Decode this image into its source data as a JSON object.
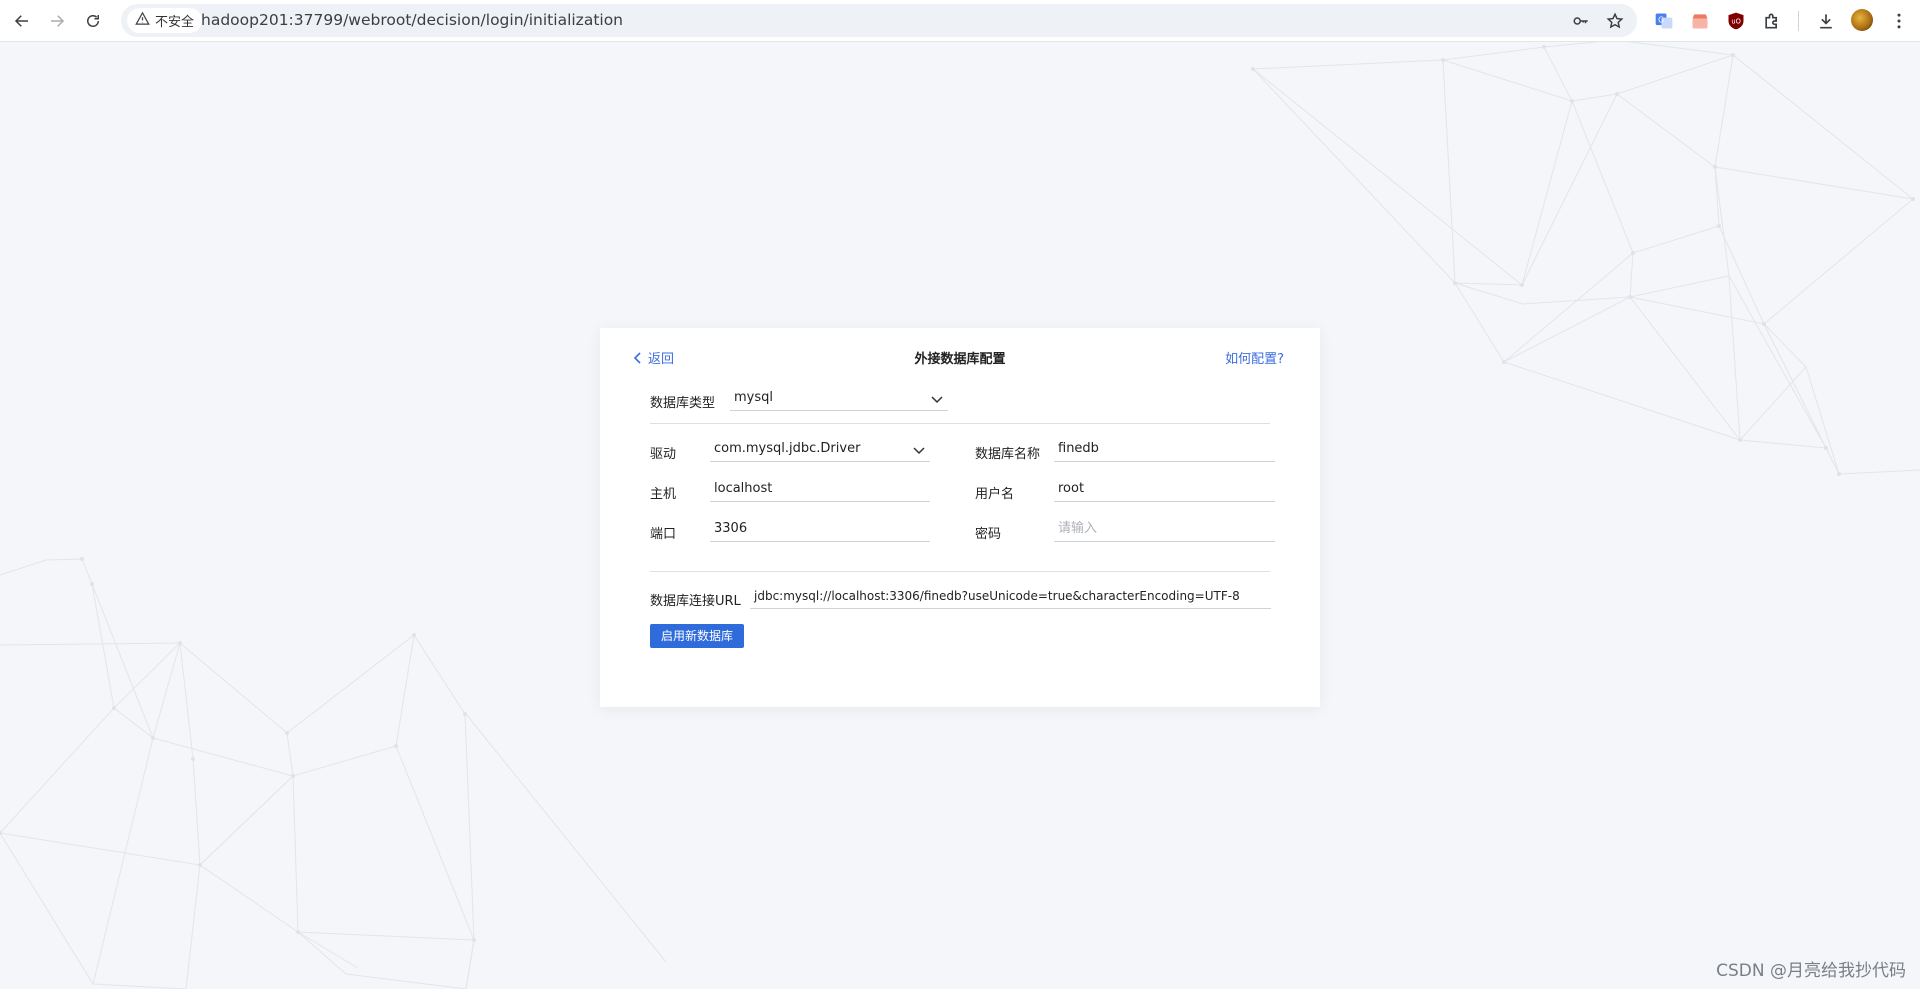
{
  "browser": {
    "security_label": "不安全",
    "url": "hadoop201:37799/webroot/decision/login/initialization",
    "nav_icons": [
      "back-arrow-icon",
      "forward-arrow-icon",
      "reload-icon"
    ],
    "omnibox_icons": [
      "password-key-icon",
      "bookmark-star-icon"
    ],
    "extension_icons": [
      "google-translate-icon",
      "store-icon",
      "ublock-icon",
      "puzzle-extensions-icon",
      "download-icon",
      "kebab-menu-icon"
    ]
  },
  "dialog": {
    "back_label": "返回",
    "title": "外接数据库配置",
    "help_label": "如何配置?",
    "db_type": {
      "label": "数据库类型",
      "value": "mysql"
    },
    "driver": {
      "label": "驱动",
      "value": "com.mysql.jdbc.Driver"
    },
    "db_name": {
      "label": "数据库名称",
      "value": "finedb"
    },
    "host": {
      "label": "主机",
      "value": "localhost"
    },
    "username": {
      "label": "用户名",
      "value": "root"
    },
    "port": {
      "label": "端口",
      "value": "3306"
    },
    "password": {
      "label": "密码",
      "placeholder": "请输入"
    },
    "url": {
      "label": "数据库连接URL",
      "value": "jdbc:mysql://localhost:3306/finedb?useUnicode=true&characterEncoding=UTF-8"
    },
    "submit_label": "启用新数据库"
  },
  "colors": {
    "accent": "#2f6bdb",
    "link": "#3b6ee0",
    "page_bg": "#f4f6f9"
  },
  "watermark": "CSDN @月亮给我抄代码"
}
